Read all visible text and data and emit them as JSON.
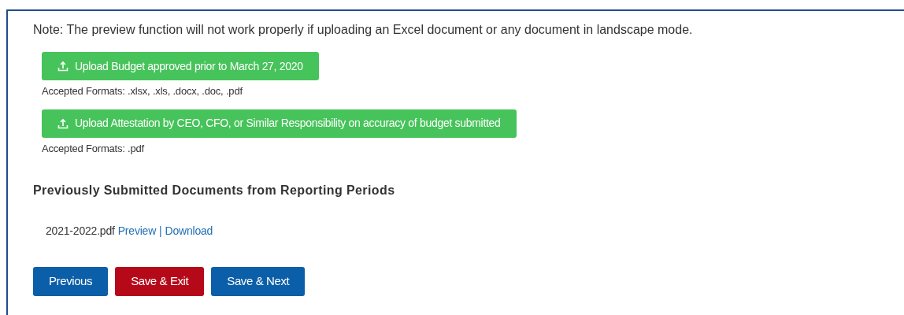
{
  "note": "Note: The preview function will not work properly if uploading an Excel document or any document in landscape mode.",
  "uploads": [
    {
      "label": "Upload Budget approved prior to March 27, 2020",
      "formats": "Accepted Formats: .xlsx, .xls, .docx, .doc, .pdf"
    },
    {
      "label": "Upload Attestation by CEO, CFO, or Similar Responsibility on accuracy of budget submitted",
      "formats": "Accepted Formats: .pdf"
    }
  ],
  "previous_heading": "Previously Submitted Documents from Reporting Periods",
  "documents": [
    {
      "file": "2021-2022.pdf",
      "preview": "Preview",
      "separator": "|",
      "download": "Download"
    }
  ],
  "buttons": [
    {
      "label": "Previous",
      "kind": "primary"
    },
    {
      "label": "Save & Exit",
      "kind": "danger"
    },
    {
      "label": "Save & Next",
      "kind": "primary"
    }
  ]
}
